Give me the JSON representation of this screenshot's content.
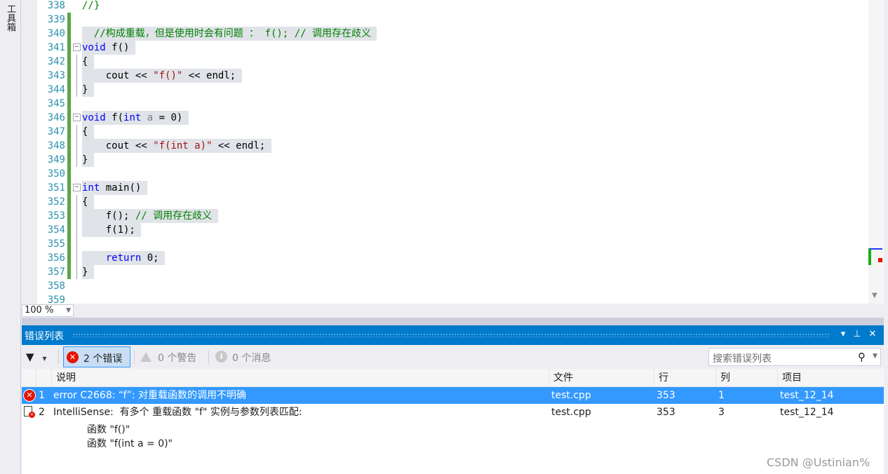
{
  "toolbox": {
    "tab_label": "工具箱"
  },
  "editor": {
    "lines": [
      {
        "n": "338",
        "text": "//}",
        "cls": "cmt"
      },
      {
        "n": "339",
        "text": "",
        "cls": ""
      },
      {
        "n": "340",
        "text": "  //构成重载，但是使用时会有问题 ： f(); // 调用存在歧义",
        "cls": "cmt"
      },
      {
        "n": "341",
        "text": "void f()",
        "cls": ""
      },
      {
        "n": "342",
        "text": "{",
        "cls": ""
      },
      {
        "n": "343",
        "text": "    cout << \"f()\" << endl;",
        "cls": ""
      },
      {
        "n": "344",
        "text": "}",
        "cls": ""
      },
      {
        "n": "345",
        "text": "",
        "cls": ""
      },
      {
        "n": "346",
        "text": "void f(int a = 0)",
        "cls": ""
      },
      {
        "n": "347",
        "text": "{",
        "cls": ""
      },
      {
        "n": "348",
        "text": "    cout << \"f(int a)\" << endl;",
        "cls": ""
      },
      {
        "n": "349",
        "text": "}",
        "cls": ""
      },
      {
        "n": "350",
        "text": "",
        "cls": ""
      },
      {
        "n": "351",
        "text": "int main()",
        "cls": ""
      },
      {
        "n": "352",
        "text": "{",
        "cls": ""
      },
      {
        "n": "353",
        "text": "    f(); // 调用存在歧义",
        "cls": ""
      },
      {
        "n": "354",
        "text": "    f(1);",
        "cls": ""
      },
      {
        "n": "355",
        "text": "",
        "cls": ""
      },
      {
        "n": "356",
        "text": "    return 0;",
        "cls": ""
      },
      {
        "n": "357",
        "text": "}",
        "cls": ""
      },
      {
        "n": "358",
        "text": "",
        "cls": ""
      },
      {
        "n": "359",
        "text": "",
        "cls": ""
      }
    ]
  },
  "zoom": {
    "value": "100 %"
  },
  "error_list": {
    "title": "错误列表",
    "toolbar": {
      "errors_label": "2 个错误",
      "warnings_label": "0 个警告",
      "messages_label": "0 个消息",
      "search_placeholder": "搜索错误列表"
    },
    "columns": {
      "description": "说明",
      "file": "文件",
      "line": "行",
      "col": "列",
      "project": "项目"
    },
    "rows": [
      {
        "index": "1",
        "description": "error C2668: “f”: 对重载函数的调用不明确",
        "file": "test.cpp",
        "line": "353",
        "col": "1",
        "project": "test_12_14"
      },
      {
        "index": "2",
        "description": "IntelliSense:  有多个 重载函数 \"f\" 实例与参数列表匹配:",
        "detail1": "函数 \"f()\"",
        "detail2": "函数 \"f(int a = 0)\"",
        "file": "test.cpp",
        "line": "353",
        "col": "3",
        "project": "test_12_14"
      }
    ]
  },
  "watermark": "CSDN @Ustinian%"
}
